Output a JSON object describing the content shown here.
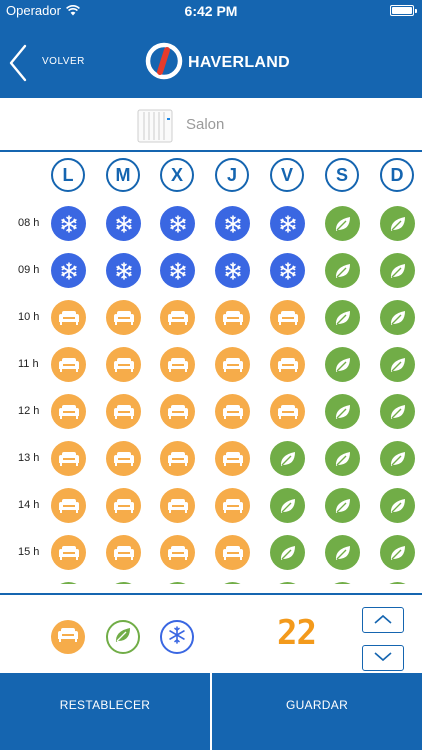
{
  "status_bar": {
    "carrier": "Operador",
    "time": "6:42 PM"
  },
  "nav": {
    "back_label": "VOLVER",
    "brand_name": "HAVERLAND"
  },
  "device": {
    "name": "Salon"
  },
  "schedule": {
    "days": [
      "L",
      "M",
      "X",
      "J",
      "V",
      "S",
      "D"
    ],
    "hours": [
      {
        "label": "08 h",
        "modes": [
          "cold",
          "cold",
          "cold",
          "cold",
          "cold",
          "eco",
          "eco"
        ]
      },
      {
        "label": "09 h",
        "modes": [
          "cold",
          "cold",
          "cold",
          "cold",
          "cold",
          "eco",
          "eco"
        ]
      },
      {
        "label": "10 h",
        "modes": [
          "comfort",
          "comfort",
          "comfort",
          "comfort",
          "comfort",
          "eco",
          "eco"
        ]
      },
      {
        "label": "11 h",
        "modes": [
          "comfort",
          "comfort",
          "comfort",
          "comfort",
          "comfort",
          "eco",
          "eco"
        ]
      },
      {
        "label": "12 h",
        "modes": [
          "comfort",
          "comfort",
          "comfort",
          "comfort",
          "comfort",
          "eco",
          "eco"
        ]
      },
      {
        "label": "13 h",
        "modes": [
          "comfort",
          "comfort",
          "comfort",
          "comfort",
          "eco",
          "eco",
          "eco"
        ]
      },
      {
        "label": "14 h",
        "modes": [
          "comfort",
          "comfort",
          "comfort",
          "comfort",
          "eco",
          "eco",
          "eco"
        ]
      },
      {
        "label": "15 h",
        "modes": [
          "comfort",
          "comfort",
          "comfort",
          "comfort",
          "eco",
          "eco",
          "eco"
        ]
      },
      {
        "label": "",
        "modes": [
          "eco",
          "eco",
          "eco",
          "eco",
          "eco",
          "eco",
          "eco"
        ]
      }
    ]
  },
  "modes": {
    "comfort": {
      "icon": "sofa-icon",
      "color": "#f6ac4a"
    },
    "eco": {
      "icon": "leaf-icon",
      "color": "#71ad47"
    },
    "cold": {
      "icon": "snowflake-icon",
      "color": "#3a67e2"
    }
  },
  "control": {
    "temperature": "22"
  },
  "footer": {
    "reset_label": "RESTABLECER",
    "save_label": "GUARDAR"
  },
  "colors": {
    "primary": "#1565b0",
    "temperature": "#f39a1c"
  }
}
